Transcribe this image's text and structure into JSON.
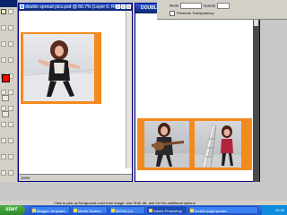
{
  "left_window": {
    "title": "double spread pics.psd @ 66.7% (Layer 0, RGB/8)",
    "status": "100%"
  },
  "right_window": {
    "title": "DOUBLE PAGE SPREAD"
  },
  "options_bar": {
    "mode_label": "Mode:",
    "opacity_label": "Opacity:",
    "preserve_transparency": "Preserve Transparency"
  },
  "status_bar": {
    "text": "Click to pick up foreground color from image. Use Shift, Alt, and Ctrl for additional options."
  },
  "taskbar": {
    "start_label": "start",
    "tasks": [
      {
        "label": "Blogger: tenyears"
      },
      {
        "label": "Media Studies"
      },
      {
        "label": "MEDIA (J:)"
      },
      {
        "label": "Adobe Photoshop"
      },
      {
        "label": "double page spread"
      }
    ],
    "clock": "22:39"
  },
  "colors": {
    "foreground": "#ff0000",
    "frame_orange": "#f28a1e",
    "titlebar": "#0a246a"
  }
}
